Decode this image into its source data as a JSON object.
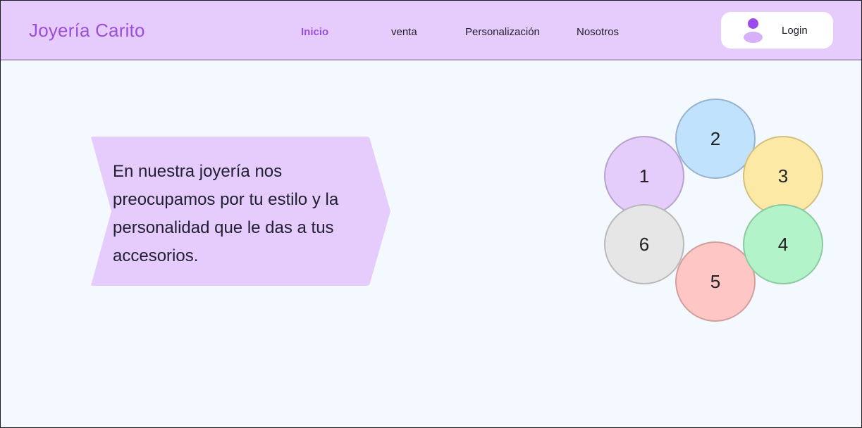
{
  "brand": "Joyería Carito",
  "nav": {
    "items": [
      {
        "label": "Inicio",
        "active": true
      },
      {
        "label": "venta",
        "active": false
      },
      {
        "label": "Personalización",
        "active": false
      },
      {
        "label": "Nosotros",
        "active": false
      }
    ]
  },
  "login": {
    "label": "Login",
    "icon": "user-icon"
  },
  "banner": {
    "text": "En nuestra joyería nos preocupamos por tu estilo y la personalidad que le das a tus accesorios."
  },
  "circles": [
    {
      "label": "1",
      "fill": "#e4cdfb",
      "stroke": "#b9a2d0"
    },
    {
      "label": "2",
      "fill": "#c0e2fc",
      "stroke": "#97b3cf"
    },
    {
      "label": "3",
      "fill": "#fde9a6",
      "stroke": "#d3c07e"
    },
    {
      "label": "4",
      "fill": "#b3f3c9",
      "stroke": "#8ccaa1"
    },
    {
      "label": "5",
      "fill": "#fec7c5",
      "stroke": "#d19f9e"
    },
    {
      "label": "6",
      "fill": "#e6e6e6",
      "stroke": "#b9b9b9"
    }
  ],
  "colors": {
    "navbar": "#e6ccfd",
    "accent": "#9b4fd6",
    "background": "#f4f8ff",
    "banner": "#e6ccfd"
  }
}
